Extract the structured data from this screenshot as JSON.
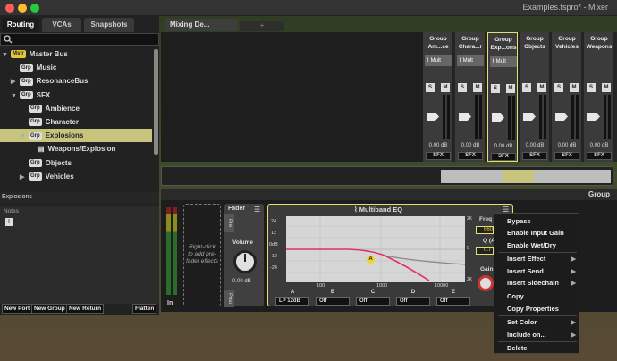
{
  "window": {
    "title": "Examples.fspro* - Mixer"
  },
  "left_panel": {
    "tabs": [
      "Routing",
      "VCAs",
      "Snapshots"
    ],
    "tree": [
      {
        "label": "Master Bus",
        "badge": "Mstr",
        "caret": "▼",
        "indent": 0
      },
      {
        "label": "Music",
        "badge": "Grp",
        "caret": "",
        "indent": 1
      },
      {
        "label": "ResonanceBus",
        "badge": "Grp",
        "caret": "▶",
        "indent": 1
      },
      {
        "label": "SFX",
        "badge": "Grp",
        "caret": "▼",
        "indent": 1
      },
      {
        "label": "Ambience",
        "badge": "Grp",
        "caret": "",
        "indent": 2
      },
      {
        "label": "Character",
        "badge": "Grp",
        "caret": "",
        "indent": 2
      },
      {
        "label": "Explosions",
        "badge": "Grp",
        "caret": "▼",
        "indent": 2,
        "selected": true
      },
      {
        "label": "Weapons/Explosion",
        "badge": "",
        "caret": "",
        "indent": 3
      },
      {
        "label": "Objects",
        "badge": "Grp",
        "caret": "",
        "indent": 2
      },
      {
        "label": "Vehicles",
        "badge": "Grp",
        "caret": "▶",
        "indent": 2
      }
    ],
    "selection_header": "Explosions",
    "notes_label": "Notes",
    "buttons": [
      "New Port",
      "New Group",
      "New Return",
      "Flatten"
    ]
  },
  "mixer": {
    "view_tab": "Mixing De...",
    "strips": [
      {
        "line1": "Group",
        "line2": "Am...ce",
        "fx": "Mult",
        "selected": false
      },
      {
        "line1": "Group",
        "line2": "Chara...r",
        "fx": "Mult",
        "selected": false
      },
      {
        "line1": "Group",
        "line2": "Exp...ons",
        "fx": "Mult",
        "selected": true
      },
      {
        "line1": "Group",
        "line2": "Objects",
        "fx": "",
        "selected": false
      },
      {
        "line1": "Group",
        "line2": "Vehicles",
        "fx": "",
        "selected": false
      },
      {
        "line1": "Group",
        "line2": "Weapons",
        "fx": "",
        "selected": false
      }
    ],
    "strip_db": "0.00 dB",
    "strip_output": "SFX",
    "strip_buttons": [
      "S",
      "M"
    ]
  },
  "deck": {
    "header": "Group",
    "input_label": "In",
    "pre_fader_hint": "Right-click to add pre-fader effects",
    "fader": {
      "title": "Fader",
      "pre": "Pre",
      "post": "Post",
      "volume_label": "Volume",
      "volume_value": "0.00 dB"
    },
    "eq": {
      "title": "Multiband EQ",
      "y_ticks": [
        "24",
        "12",
        "0dB",
        "-12",
        "-24"
      ],
      "x_ticks": [
        "100",
        "1000",
        "10000"
      ],
      "right_ticks": [
        "2K",
        "0",
        "2K"
      ],
      "band_marker": "A",
      "bands": [
        {
          "label": "A",
          "value": "LP 12dB"
        },
        {
          "label": "B",
          "value": "Off"
        },
        {
          "label": "C",
          "value": "Off"
        },
        {
          "label": "D",
          "value": "Off"
        },
        {
          "label": "E",
          "value": "Off"
        }
      ],
      "freq_label": "Freq",
      "freq_value": "660",
      "q_label": "Q (A)",
      "q_value": "0.7",
      "gain_label": "Gain"
    }
  },
  "context_menu": {
    "items": [
      {
        "label": "Bypass",
        "submenu": false
      },
      {
        "label": "Enable Input Gain",
        "submenu": false
      },
      {
        "label": "Enable Wet/Dry",
        "submenu": false
      },
      {
        "label": "Insert Effect",
        "submenu": true
      },
      {
        "label": "Insert Send",
        "submenu": true
      },
      {
        "label": "Insert Sidechain",
        "submenu": true
      },
      {
        "label": "Copy",
        "submenu": false
      },
      {
        "label": "Copy Properties",
        "submenu": false
      },
      {
        "label": "Set Color",
        "submenu": true
      },
      {
        "label": "Include on...",
        "submenu": true
      },
      {
        "label": "Delete",
        "submenu": false
      }
    ],
    "submenu_arrow": "▶"
  },
  "colors": {
    "accent": "#e4e070",
    "selection": "#c7c57d",
    "master_badge": "#e4c83b",
    "eq_curve": "#e0306a"
  }
}
